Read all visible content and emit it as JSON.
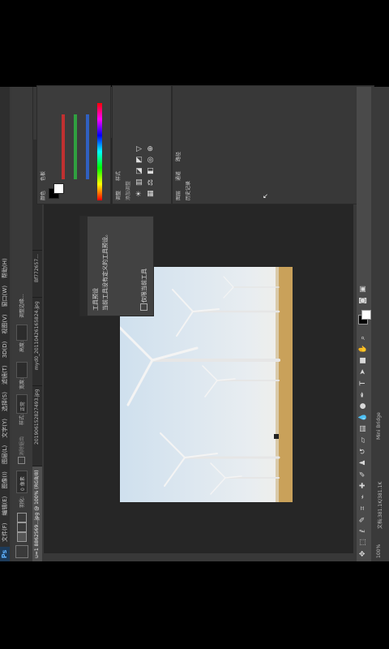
{
  "app": {
    "logo": "Ps"
  },
  "menu": [
    "文件(F)",
    "编辑(E)",
    "图像(I)",
    "图层(L)",
    "文字(Y)",
    "选择(S)",
    "滤镜(T)",
    "3D(D)",
    "视图(V)",
    "窗口(W)",
    "帮助(H)"
  ],
  "options": {
    "feather_label": "羽化:",
    "feather_value": "0 像素",
    "antialias_label": "消除锯齿",
    "style_label": "样式:",
    "style_value": "正常",
    "width_label": "宽度:",
    "height_label": "高度:",
    "refine_label": "调整边缘..."
  },
  "tabs": [
    {
      "label": "u=1 8862569...jpg @ 100% (RGB/8)",
      "active": true
    },
    {
      "label": "201906152827493.jpg",
      "active": false
    },
    {
      "label": "myd0_20110426165824.jpg",
      "active": false
    },
    {
      "label": "Bf772657...",
      "active": false
    }
  ],
  "status": {
    "zoom": "100%",
    "doc": "文档:381.1K/381.1K",
    "mini": "Mini Bridge"
  },
  "popup": {
    "title": "工具预设",
    "line1": "当前工具没有定义的工具预设。",
    "checkbox": "仅限当前工具"
  },
  "panels": {
    "color_tab": "颜色",
    "swatches_tab": "色板",
    "adjust_tab": "调整",
    "styles_tab": "样式",
    "adjust_hint": "添加调整",
    "layers_tab": "图层",
    "channels_tab": "通道",
    "paths_tab": "路径",
    "history_tab": "历史记录"
  },
  "colors": {
    "bg": "#383838",
    "canvas": "#262626",
    "accent": "#5fb2ff"
  }
}
